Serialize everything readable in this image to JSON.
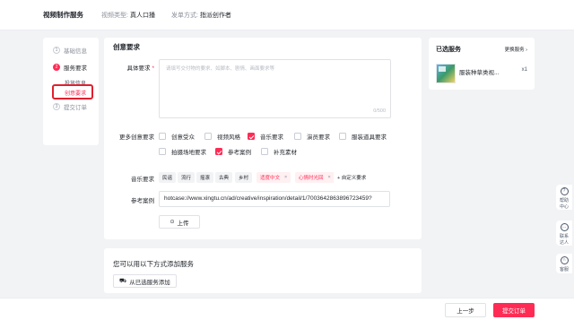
{
  "header": {
    "title": "视频制作服务",
    "video_type_label": "视频类型:",
    "video_type_value": "真人口播",
    "order_method_label": "发单方式:",
    "order_method_value": "指派创作者"
  },
  "steps": [
    {
      "num": "1",
      "label": "基础信息"
    },
    {
      "num": "2",
      "label": "服务要求"
    },
    {
      "num": "3",
      "label": "提交订单"
    }
  ],
  "sub_steps": [
    "投放信息",
    "创意要求"
  ],
  "main": {
    "title": "创意要求",
    "specific_label": "具体要求",
    "required_mark": "*",
    "textarea_placeholder": "请填写交付物的要求、如脚本、剧情、画面要求等",
    "textarea_count": "0/500",
    "more_label": "更多创意要求",
    "options": [
      {
        "label": "创意受众",
        "checked": false
      },
      {
        "label": "视频风格",
        "checked": false
      },
      {
        "label": "音乐要求",
        "checked": true
      },
      {
        "label": "演员要求",
        "checked": false
      },
      {
        "label": "服装道具要求",
        "checked": false
      },
      {
        "label": "拍摄场地要求",
        "checked": false
      },
      {
        "label": "参考案例",
        "checked": true
      },
      {
        "label": "补充素材",
        "checked": false
      }
    ],
    "music_label": "音乐要求",
    "music_tags": [
      "民谣",
      "流行",
      "摇滚",
      "古典",
      "乡村"
    ],
    "music_selected": [
      "适度中文",
      "心情时光回"
    ],
    "custom_tag": "+ 自定义要求",
    "ref_label": "参考案例",
    "ref_value": "hotcase://www.xingtu.cn/ad/creative/inspiration/detail/1/7003642863896723459?",
    "upload_label": "上传"
  },
  "add_service": {
    "title": "您可以用以下方式添加服务",
    "button": "从已选服务添加"
  },
  "selected": {
    "title": "已选服务",
    "change": "更换服务 ›",
    "item_name": "服装种草类视...",
    "item_qty": "x1"
  },
  "float": [
    {
      "label1": "帮助",
      "label2": "中心",
      "icon": "help-icon"
    },
    {
      "label1": "联系",
      "label2": "达人",
      "icon": "contact-icon"
    },
    {
      "label1": "客服",
      "label2": "",
      "icon": "headset-icon"
    }
  ],
  "footer": {
    "prev": "上一步",
    "submit": "提交订单"
  }
}
